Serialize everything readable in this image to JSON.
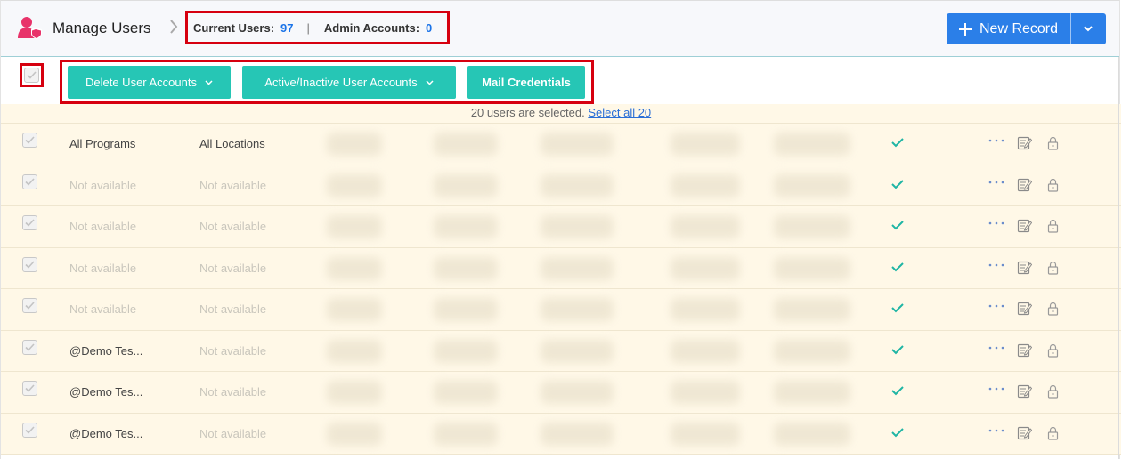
{
  "header": {
    "title": "Manage Users",
    "current_users_label": "Current Users:",
    "current_users_value": "97",
    "separator": "|",
    "admin_accounts_label": "Admin Accounts:",
    "admin_accounts_value": "0",
    "new_record_label": "New Record"
  },
  "actions": {
    "delete_label": "Delete User Accounts",
    "active_label": "Active/Inactive User Accounts",
    "mail_label": "Mail Credentials"
  },
  "notice": {
    "text": "20 users are selected.",
    "link": "Select all 20"
  },
  "rows": [
    {
      "program": "All Programs",
      "location": "All Locations",
      "program_muted": false,
      "location_muted": false
    },
    {
      "program": "Not available",
      "location": "Not available",
      "program_muted": true,
      "location_muted": true
    },
    {
      "program": "Not available",
      "location": "Not available",
      "program_muted": true,
      "location_muted": true
    },
    {
      "program": "Not available",
      "location": "Not available",
      "program_muted": true,
      "location_muted": true
    },
    {
      "program": "Not available",
      "location": "Not available",
      "program_muted": true,
      "location_muted": true
    },
    {
      "program": "@Demo Tes...",
      "location": "Not available",
      "program_muted": false,
      "location_muted": true
    },
    {
      "program": "@Demo Tes...",
      "location": "Not available",
      "program_muted": false,
      "location_muted": true
    },
    {
      "program": "@Demo Tes...",
      "location": "Not available",
      "program_muted": false,
      "location_muted": true
    }
  ],
  "colors": {
    "accent": "#26c6b5",
    "primary": "#2b7fe8",
    "highlight": "#d6000f",
    "row_bg": "#fff8e7"
  },
  "icons": [
    "users-icon",
    "chevron-right-icon",
    "plus-icon",
    "chevron-down-icon",
    "checkbox-icon",
    "checkmark-icon",
    "more-icon",
    "edit-icon",
    "lock-icon"
  ]
}
